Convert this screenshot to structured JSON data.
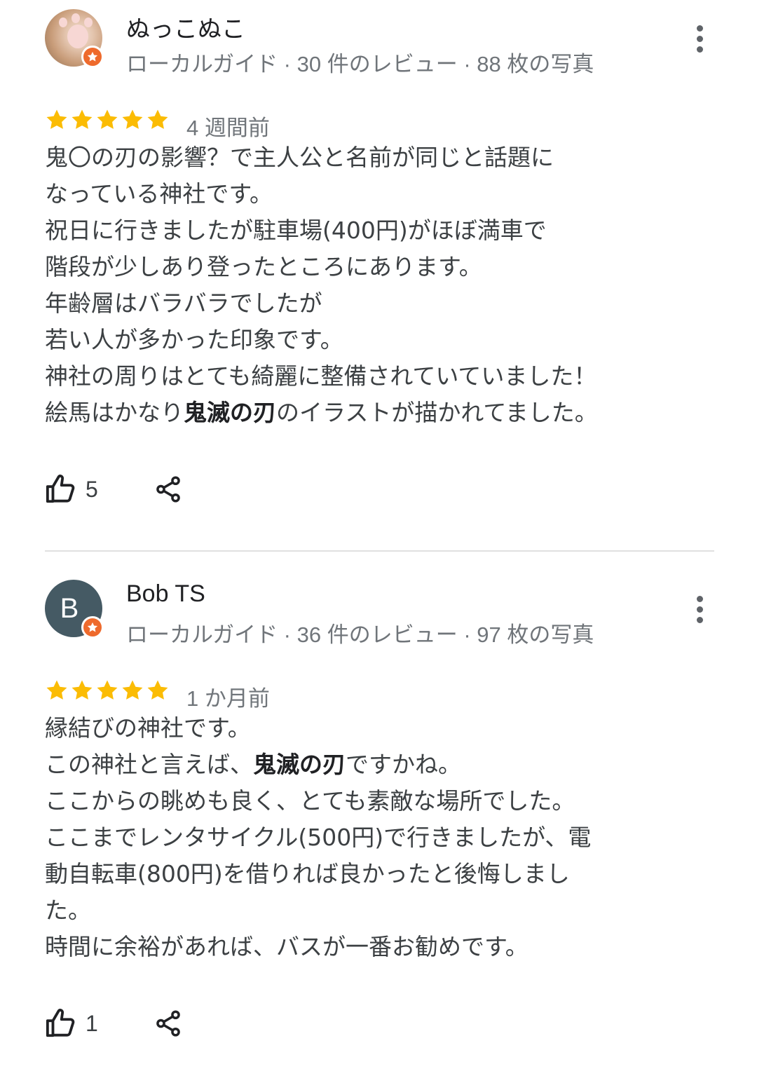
{
  "reviews": [
    {
      "author": "ぬっこぬこ",
      "meta": "ローカルガイド · 30 件のレビュー · 88 枚の写真",
      "rating": 5,
      "date": "4 週間前",
      "lines": [
        {
          "before": "鬼〇の刃の影響？で主人公と名前が同じと話題に",
          "bold": "",
          "after": ""
        },
        {
          "before": "なっている神社です。",
          "bold": "",
          "after": ""
        },
        {
          "before": "祝日に行きましたが駐車場(400円)がほぼ満車で",
          "bold": "",
          "after": ""
        },
        {
          "before": "階段が少しあり登ったところにあります。",
          "bold": "",
          "after": ""
        },
        {
          "before": "年齢層はバラバラでしたが",
          "bold": "",
          "after": ""
        },
        {
          "before": "若い人が多かった印象です。",
          "bold": "",
          "after": ""
        },
        {
          "before": "神社の周りはとても綺麗に整備されていていました！",
          "bold": "",
          "after": ""
        },
        {
          "before": "絵馬はかなり",
          "bold": "鬼滅の刃",
          "after": "のイラストが描かれてました。"
        }
      ],
      "likes": "5"
    },
    {
      "author": "Bob TS",
      "avatar_letter": "B",
      "meta": "ローカルガイド · 36 件のレビュー · 97 枚の写真",
      "rating": 5,
      "date": "1 か月前",
      "lines": [
        {
          "before": "縁結びの神社です。",
          "bold": "",
          "after": ""
        },
        {
          "before": "この神社と言えば、",
          "bold": "鬼滅の刃",
          "after": "ですかね。"
        },
        {
          "before": "ここからの眺めも良く、とても素敵な場所でした。",
          "bold": "",
          "after": ""
        },
        {
          "before": "ここまでレンタサイクル(500円)で行きましたが、電",
          "bold": "",
          "after": ""
        },
        {
          "before": "動自転車(800円)を借りれば良かったと後悔しまし",
          "bold": "",
          "after": ""
        },
        {
          "before": "た。",
          "bold": "",
          "after": ""
        },
        {
          "before": "時間に余裕があれば、バスが一番お勧めです。",
          "bold": "",
          "after": ""
        }
      ],
      "likes": "1"
    }
  ],
  "colors": {
    "star": "#fbbc04",
    "guide_badge": "#ee6a2c",
    "avatar_bg": "#455a64",
    "meta_text": "#70757a"
  },
  "icons": {
    "star": "star-icon",
    "guide_badge": "local-guide-badge-icon",
    "more": "more-vert-icon",
    "like": "thumb-up-icon",
    "share": "share-icon"
  }
}
